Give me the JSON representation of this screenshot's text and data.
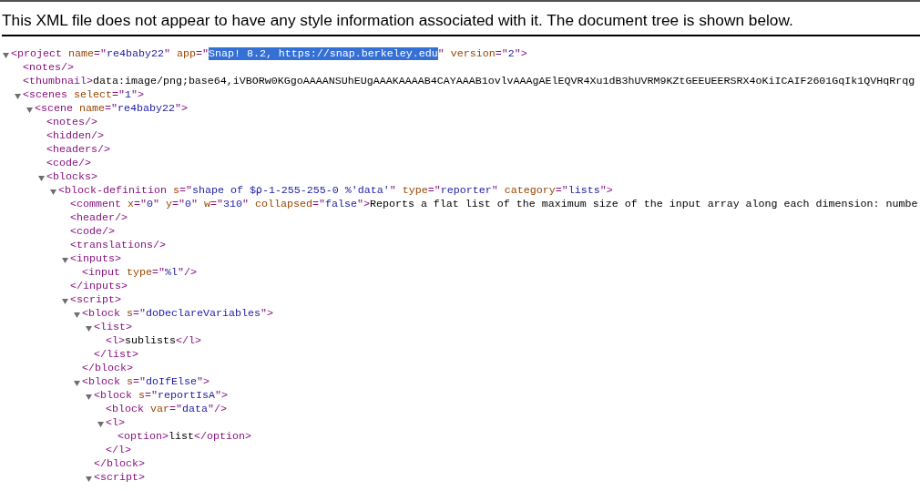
{
  "notice": "This XML file does not appear to have any style information associated with it. The document tree is shown below.",
  "tree": [
    {
      "kind": "element",
      "expanded": true,
      "line": [
        {
          "text": "<project name=\"re4baby22\" app=\"",
          "selected": false
        },
        {
          "text": "Snap! 8.2, https://snap.berkeley.edu",
          "selected": true
        },
        {
          "text": "\" version=\"2\">",
          "selected": false
        }
      ],
      "children": [
        {
          "kind": "leaf",
          "line": [
            {
              "text": "<notes/>",
              "selected": false
            }
          ]
        },
        {
          "kind": "leaf",
          "line": [
            {
              "text": "<thumbnail>data:image/png;base64,iVBORw0KGgoAAAANSUhEUgAAAKAAAAB4CAYAAAB1ovlvAAAgAElEQVR4Xu1dB3hUVRM9KZtGEEUEERSRX4oKiICAIF2601GqIk1QVHqRrqg",
              "selected": false
            }
          ]
        },
        {
          "kind": "element",
          "expanded": true,
          "line": [
            {
              "text": "<scenes select=\"1\">",
              "selected": false
            }
          ],
          "children": [
            {
              "kind": "element",
              "expanded": true,
              "line": [
                {
                  "text": "<scene name=\"re4baby22\">",
                  "selected": false
                }
              ],
              "children": [
                {
                  "kind": "leaf",
                  "line": [
                    {
                      "text": "<notes/>",
                      "selected": false
                    }
                  ]
                },
                {
                  "kind": "leaf",
                  "line": [
                    {
                      "text": "<hidden/>",
                      "selected": false
                    }
                  ]
                },
                {
                  "kind": "leaf",
                  "line": [
                    {
                      "text": "<headers/>",
                      "selected": false
                    }
                  ]
                },
                {
                  "kind": "leaf",
                  "line": [
                    {
                      "text": "<code/>",
                      "selected": false
                    }
                  ]
                },
                {
                  "kind": "element",
                  "expanded": true,
                  "line": [
                    {
                      "text": "<blocks>",
                      "selected": false
                    }
                  ],
                  "children": [
                    {
                      "kind": "element",
                      "expanded": true,
                      "line": [
                        {
                          "text": "<block-definition s=\"shape of $⍴-1-255-255-0 %'data'\" type=\"reporter\" category=\"lists\">",
                          "selected": false
                        }
                      ],
                      "children": [
                        {
                          "kind": "leaf",
                          "line": [
                            {
                              "text": "<comment x=\"0\" y=\"0\" w=\"310\" collapsed=\"false\">Reports a flat list of the maximum size of the input array along each dimension: numbe",
                              "selected": false
                            }
                          ]
                        },
                        {
                          "kind": "leaf",
                          "line": [
                            {
                              "text": "<header/>",
                              "selected": false
                            }
                          ]
                        },
                        {
                          "kind": "leaf",
                          "line": [
                            {
                              "text": "<code/>",
                              "selected": false
                            }
                          ]
                        },
                        {
                          "kind": "leaf",
                          "line": [
                            {
                              "text": "<translations/>",
                              "selected": false
                            }
                          ]
                        },
                        {
                          "kind": "element",
                          "expanded": true,
                          "line": [
                            {
                              "text": "<inputs>",
                              "selected": false
                            }
                          ],
                          "children": [
                            {
                              "kind": "leaf",
                              "line": [
                                {
                                  "text": "<input type=\"%l\"/>",
                                  "selected": false
                                }
                              ]
                            }
                          ],
                          "close": [
                            {
                              "text": "</inputs>",
                              "selected": false
                            }
                          ]
                        },
                        {
                          "kind": "element",
                          "expanded": true,
                          "line": [
                            {
                              "text": "<script>",
                              "selected": false
                            }
                          ],
                          "children": [
                            {
                              "kind": "element",
                              "expanded": true,
                              "line": [
                                {
                                  "text": "<block s=\"doDeclareVariables\">",
                                  "selected": false
                                }
                              ],
                              "children": [
                                {
                                  "kind": "element",
                                  "expanded": true,
                                  "line": [
                                    {
                                      "text": "<list>",
                                      "selected": false
                                    }
                                  ],
                                  "children": [
                                    {
                                      "kind": "leaf",
                                      "line": [
                                        {
                                          "text": "<l>sublists</l>",
                                          "selected": false
                                        }
                                      ]
                                    }
                                  ],
                                  "close": [
                                    {
                                      "text": "</list>",
                                      "selected": false
                                    }
                                  ]
                                }
                              ],
                              "close": [
                                {
                                  "text": "</block>",
                                  "selected": false
                                }
                              ]
                            },
                            {
                              "kind": "element",
                              "expanded": true,
                              "line": [
                                {
                                  "text": "<block s=\"doIfElse\">",
                                  "selected": false
                                }
                              ],
                              "children": [
                                {
                                  "kind": "element",
                                  "expanded": true,
                                  "line": [
                                    {
                                      "text": "<block s=\"reportIsA\">",
                                      "selected": false
                                    }
                                  ],
                                  "children": [
                                    {
                                      "kind": "leaf",
                                      "line": [
                                        {
                                          "text": "<block var=\"data\"/>",
                                          "selected": false
                                        }
                                      ]
                                    },
                                    {
                                      "kind": "element",
                                      "expanded": true,
                                      "line": [
                                        {
                                          "text": "<l>",
                                          "selected": false
                                        }
                                      ],
                                      "children": [
                                        {
                                          "kind": "leaf",
                                          "line": [
                                            {
                                              "text": "<option>list</option>",
                                              "selected": false
                                            }
                                          ]
                                        }
                                      ],
                                      "close": [
                                        {
                                          "text": "</l>",
                                          "selected": false
                                        }
                                      ]
                                    }
                                  ],
                                  "close": [
                                    {
                                      "text": "</block>",
                                      "selected": false
                                    }
                                  ]
                                },
                                {
                                  "kind": "element",
                                  "expanded": true,
                                  "line": [
                                    {
                                      "text": "<script>",
                                      "selected": false
                                    }
                                  ]
                                }
                              ]
                            }
                          ]
                        }
                      ]
                    }
                  ]
                }
              ]
            }
          ]
        }
      ]
    }
  ]
}
